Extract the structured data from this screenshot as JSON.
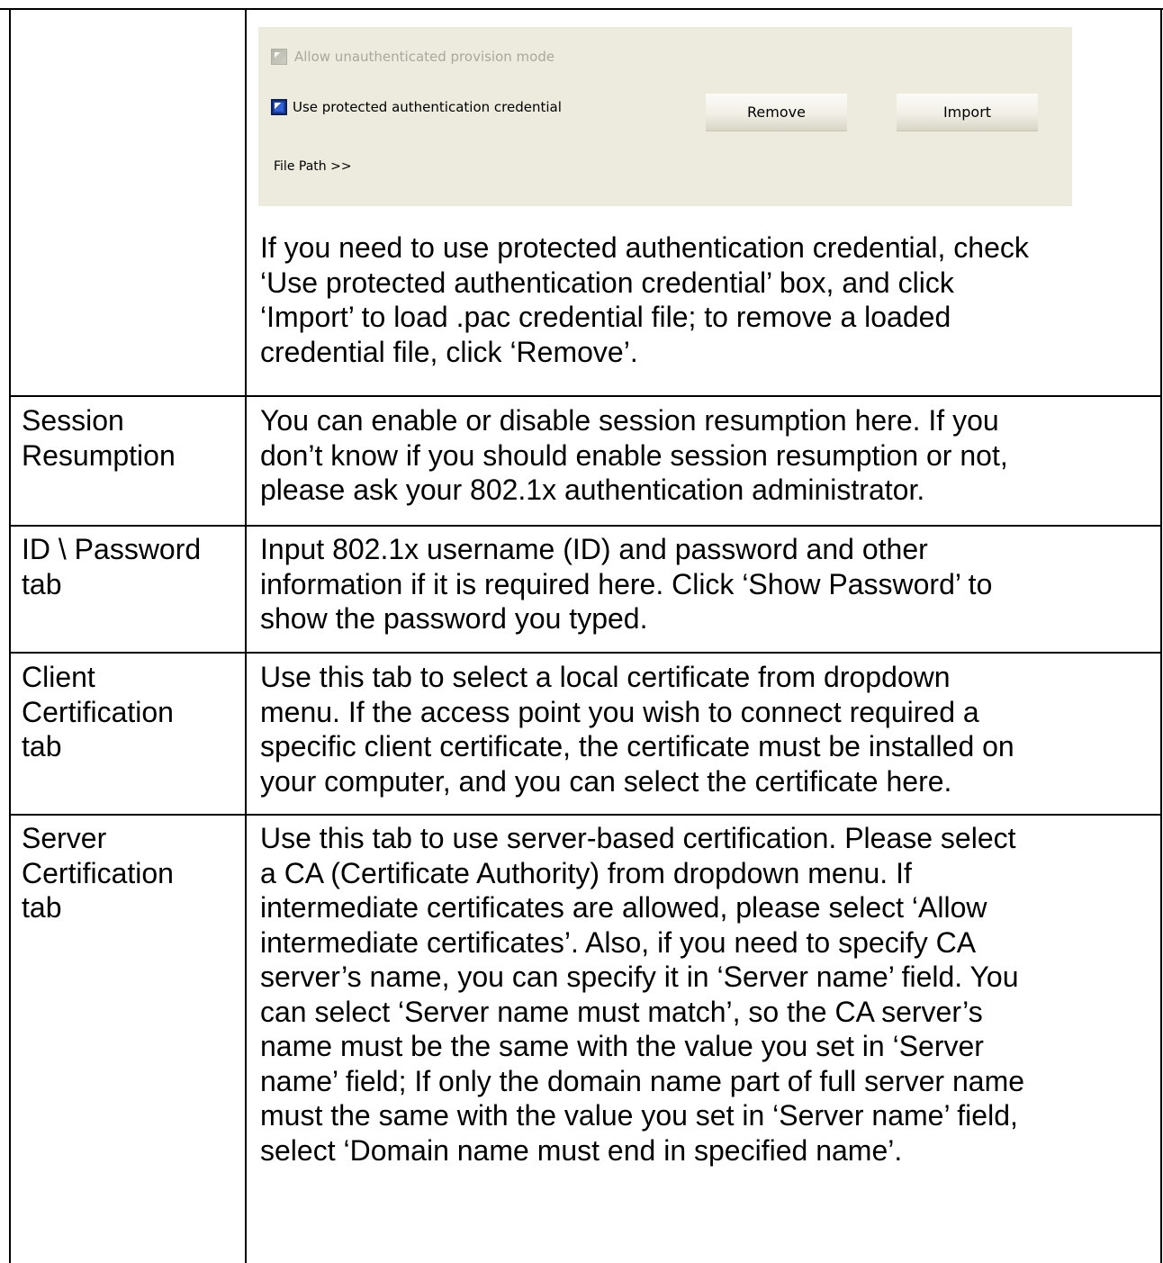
{
  "dialog": {
    "allow_unauth_label": "Allow unauthenticated provision mode",
    "use_protected_label": "Use protected authentication credential",
    "remove_button": "Remove",
    "import_button": "Import",
    "file_path_label": "File Path >>"
  },
  "rows": [
    {
      "description": [
        "If you need to use protected authentication credential, check",
        "‘Use protected authentication credential’ box, and click",
        "‘Import’ to load .pac credential file; to remove a loaded",
        "credential file, click ‘Remove’."
      ]
    },
    {
      "term": [
        "Session",
        "Resumption"
      ],
      "description": [
        "You can enable or disable session resumption here. If you",
        "don’t know if you should enable session resumption or not,",
        "please ask your 802.1x authentication administrator."
      ]
    },
    {
      "term": [
        "ID \\ Password",
        "tab"
      ],
      "description": [
        "Input 802.1x username (ID) and password and other",
        "information if it is required here. Click ‘Show Password’ to",
        "show the password you typed."
      ]
    },
    {
      "term": [
        "Client",
        "Certification",
        "tab"
      ],
      "description": [
        "Use this tab to select a local certificate from dropdown",
        "menu. If the access point you wish to connect required a",
        "specific client certificate, the certificate must be installed on",
        "your computer, and you can select the certificate here."
      ]
    },
    {
      "term": [
        "Server",
        "Certification",
        "tab"
      ],
      "description": [
        "Use this tab to use server-based certification. Please select",
        "a CA (Certificate Authority) from dropdown menu. If",
        "intermediate certificates are allowed, please select ‘Allow",
        "intermediate certificates’. Also, if you need to specify CA",
        "server’s name, you can specify it in ‘Server name’ field. You",
        "can select ‘Server name must match’, so the CA server’s",
        "name must be the same with the value you set in ‘Server",
        "name’ field; If only the domain name part of full server name",
        "must the same with the value you set in ‘Server name’ field,",
        "select ‘Domain name must end in specified name’."
      ]
    }
  ]
}
